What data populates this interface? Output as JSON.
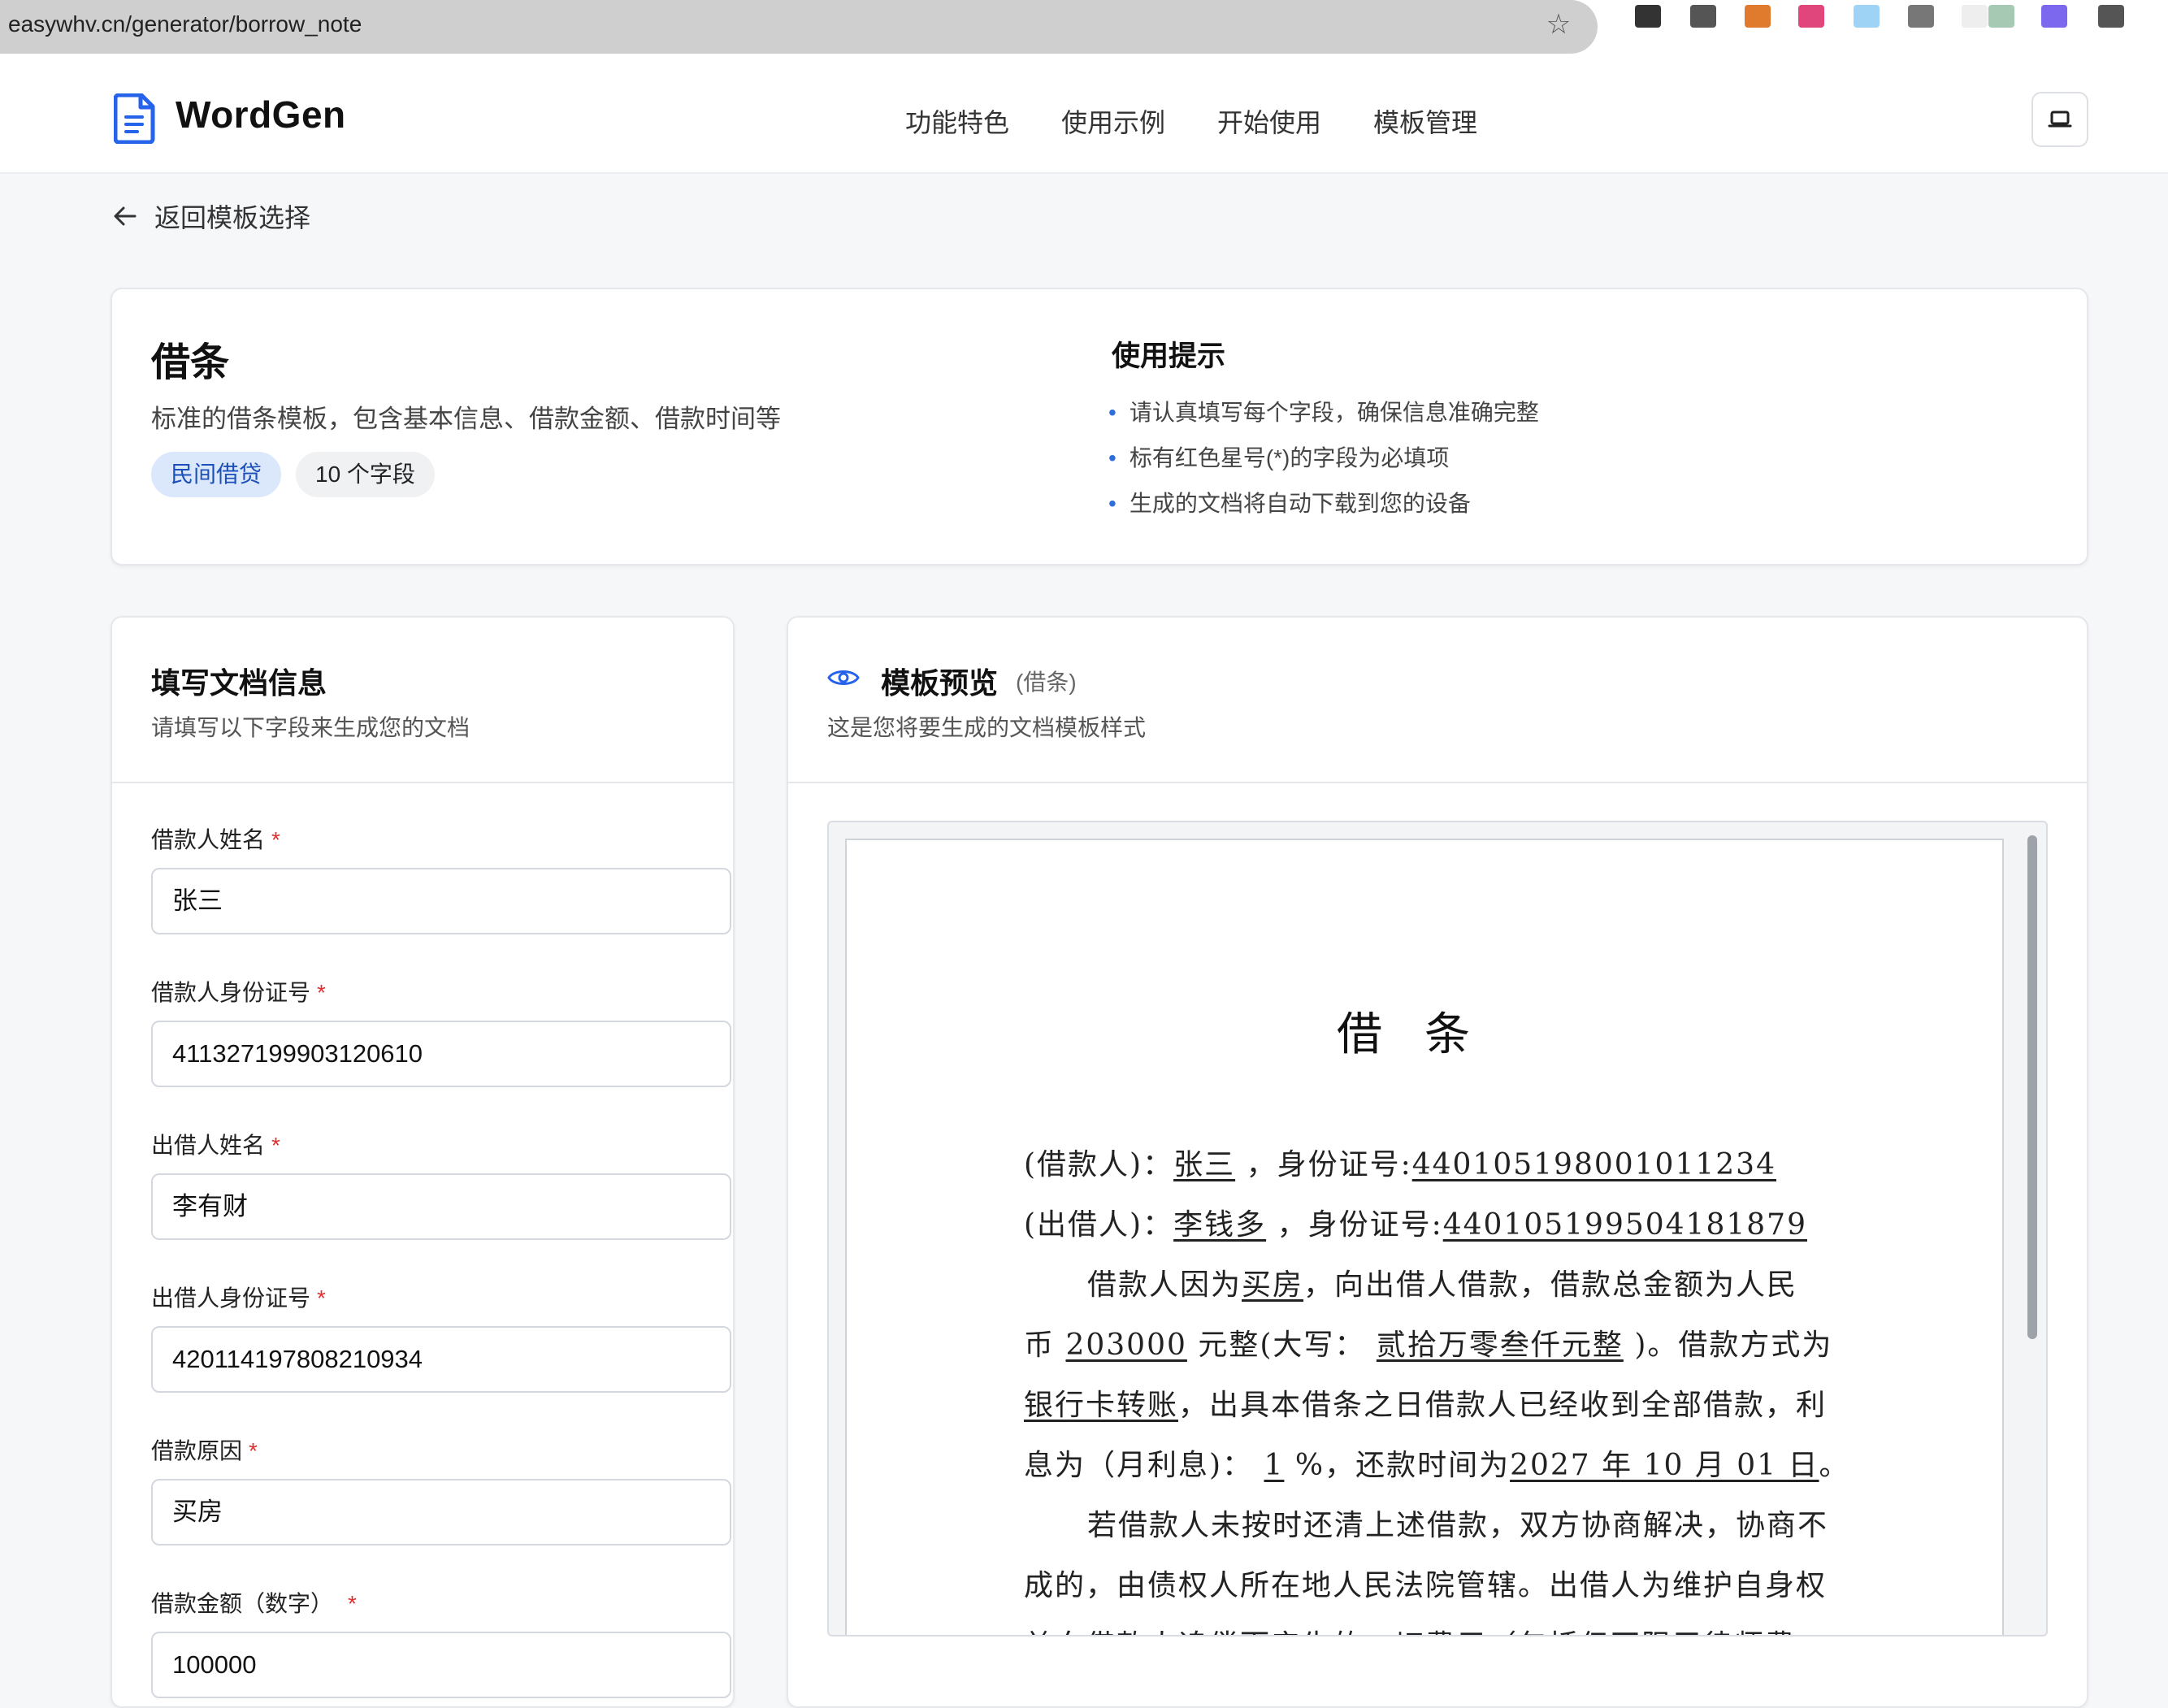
{
  "browser": {
    "url": "easywhv.cn/generator/borrow_note",
    "extension_colors": [
      "#333333",
      "#555555",
      "#e07b2e",
      "#e0457b",
      "#9fd3f5",
      "#777777",
      "#eeeeee",
      "#a6c9b4",
      "#7b68ee",
      "#555555"
    ]
  },
  "header": {
    "brand": "WordGen",
    "nav": [
      "功能特色",
      "使用示例",
      "开始使用",
      "模板管理"
    ]
  },
  "back_label": "返回模板选择",
  "template": {
    "title": "借条",
    "description": "标准的借条模板，包含基本信息、借款金额、借款时间等",
    "category_tag": "民间借贷",
    "field_count_tag": "10 个字段"
  },
  "tips": {
    "title": "使用提示",
    "items": [
      "请认真填写每个字段，确保信息准确完整",
      "标有红色星号(*)的字段为必填项",
      "生成的文档将自动下载到您的设备"
    ]
  },
  "form": {
    "title": "填写文档信息",
    "subtitle": "请填写以下字段来生成您的文档",
    "required_mark": "*",
    "fields": [
      {
        "label": "借款人姓名",
        "value": "张三"
      },
      {
        "label": "借款人身份证号",
        "value": "411327199903120610"
      },
      {
        "label": "出借人姓名",
        "value": "李有财"
      },
      {
        "label": "出借人身份证号",
        "value": "420114197808210934"
      },
      {
        "label": "借款原因",
        "value": "买房"
      },
      {
        "label": "借款金额（数字）",
        "value": "100000"
      }
    ]
  },
  "preview": {
    "title": "模板预览",
    "paren": "(借条)",
    "subtitle": "这是您将要生成的文档模板样式",
    "doc": {
      "title": "借条",
      "l1a": "(借款人)：",
      "l1b": "张三",
      "l1c": "，身份证号:",
      "l1d": "440105198001011234",
      "l2a": "(出借人)：",
      "l2b": "李钱多",
      "l2c": "，身份证号:",
      "l2d": "440105199504181879",
      "l3a": "借款人因为",
      "l3b": "买房",
      "l3c": "，向出借人借款，借款总金额为人民",
      "l4a": "币",
      "l4b": "203000",
      "l4c": "元整(大写：",
      "l4d": "贰拾万零叁仟元整",
      "l4e": ")。借款方式为",
      "l5a": "银行卡转账",
      "l5b": "，出具本借条之日借款人已经收到全部借款，利",
      "l6a": "息为（月利息)：",
      "l6b": "1",
      "l6c": "%，还款时间为",
      "l6d": "2027 年 10 月 01 日",
      "l6e": "。",
      "l7": "若借款人未按时还清上述借款，双方协商解决，协商不",
      "l8": "成的，由债权人所在地人民法院管辖。出借人为维护自身权",
      "l9": "益向借款人追偿而产生的一切费用（包括但不限于律师费、"
    }
  }
}
